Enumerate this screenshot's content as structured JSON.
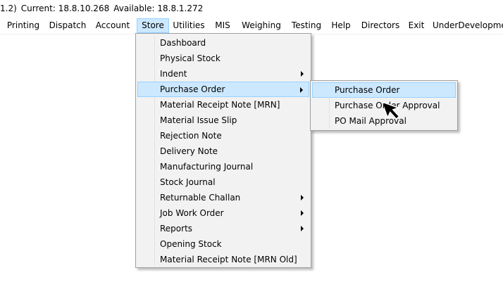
{
  "titlebar": {
    "version_fragment": "1.2)",
    "current": "Current: 18.8.10.268",
    "available": "Available: 18.8.1.272"
  },
  "menubar": [
    {
      "label": "Printing"
    },
    {
      "label": "Dispatch"
    },
    {
      "label": "Account"
    },
    {
      "label": "Store"
    },
    {
      "label": "Utilities"
    },
    {
      "label": "MIS"
    },
    {
      "label": "Weighing"
    },
    {
      "label": "Testing"
    },
    {
      "label": "Help"
    },
    {
      "label": "Directors"
    },
    {
      "label": "Exit"
    },
    {
      "label": "UnderDevelopment"
    }
  ],
  "store_menu": [
    {
      "label": "Dashboard",
      "has_submenu": false
    },
    {
      "label": "Physical Stock",
      "has_submenu": false
    },
    {
      "label": "Indent",
      "has_submenu": true
    },
    {
      "label": "Purchase Order",
      "has_submenu": true
    },
    {
      "label": "Material Receipt Note [MRN]",
      "has_submenu": false
    },
    {
      "label": "Material Issue Slip",
      "has_submenu": false
    },
    {
      "label": "Rejection Note",
      "has_submenu": false
    },
    {
      "label": "Delivery Note",
      "has_submenu": false
    },
    {
      "label": "Manufacturing Journal",
      "has_submenu": false
    },
    {
      "label": "Stock Journal",
      "has_submenu": false
    },
    {
      "label": "Returnable Challan",
      "has_submenu": true
    },
    {
      "label": "Job Work Order",
      "has_submenu": true
    },
    {
      "label": "Reports",
      "has_submenu": true
    },
    {
      "label": "Opening Stock",
      "has_submenu": false
    },
    {
      "label": "Material Receipt Note [MRN Old]",
      "has_submenu": false
    }
  ],
  "purchase_order_submenu": [
    {
      "label": "Purchase Order"
    },
    {
      "label": "Purchase Order Approval"
    },
    {
      "label": "PO Mail Approval"
    }
  ],
  "colors": {
    "highlight_bg": "#cce8ff",
    "highlight_border": "#99d1ff",
    "menu_bg": "#f2f2f2"
  },
  "icons": {
    "cursor": "mouse-pointer-icon",
    "submenu_arrow": "chevron-right-icon"
  }
}
